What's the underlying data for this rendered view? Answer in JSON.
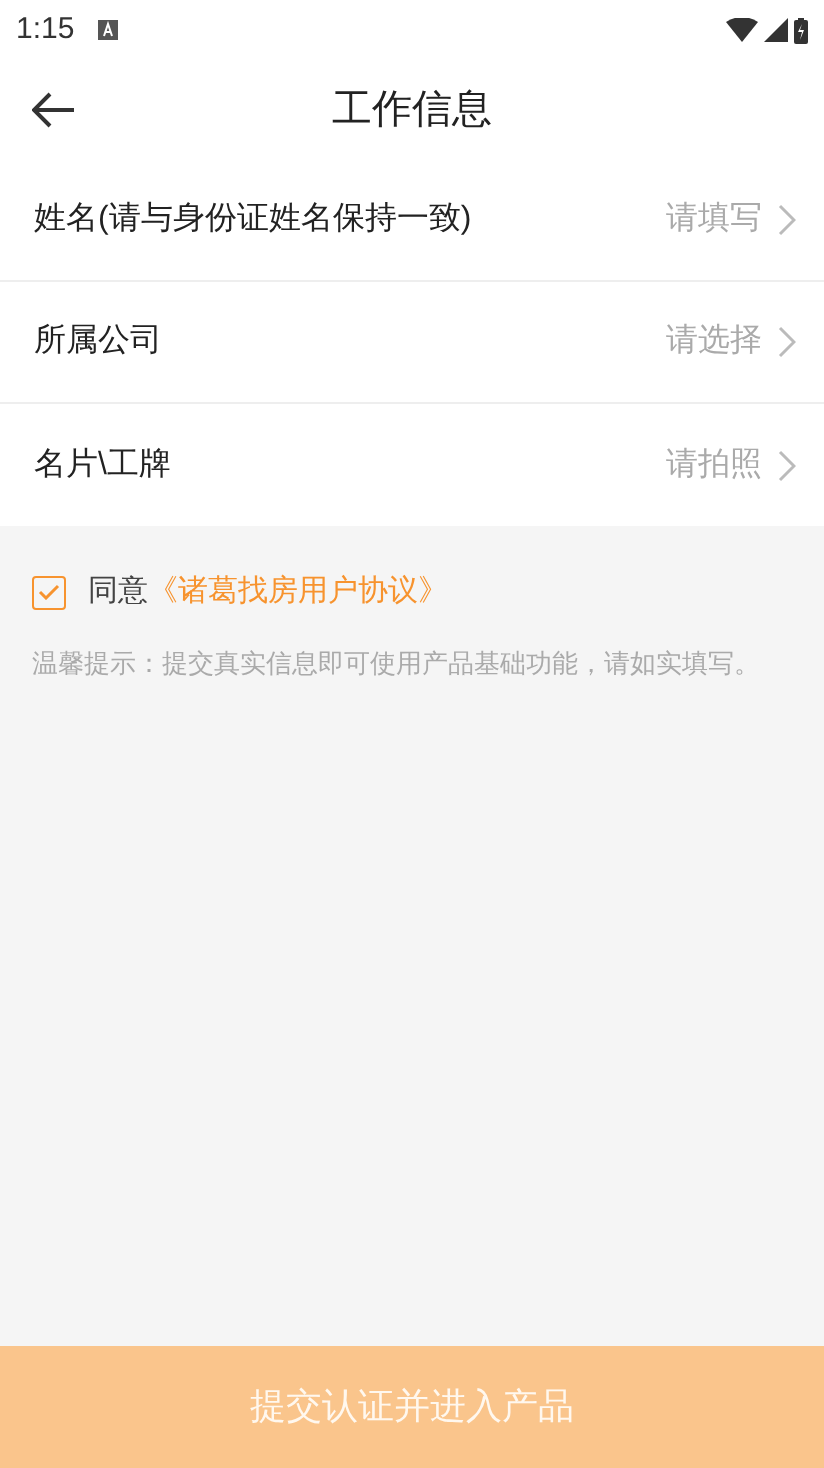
{
  "status_bar": {
    "time": "1:15"
  },
  "header": {
    "title": "工作信息"
  },
  "form_rows": [
    {
      "label": "姓名(请与身份证姓名保持一致)",
      "value": "请填写"
    },
    {
      "label": "所属公司",
      "value": "请选择"
    },
    {
      "label": "名片\\工牌",
      "value": "请拍照"
    }
  ],
  "agreement": {
    "checked": true,
    "prefix": "同意",
    "link": "《诸葛找房用户协议》"
  },
  "hint": "温馨提示：提交真实信息即可使用产品基础功能，请如实填写。",
  "submit_button": {
    "label": "提交认证并进入产品",
    "disabled": true
  }
}
